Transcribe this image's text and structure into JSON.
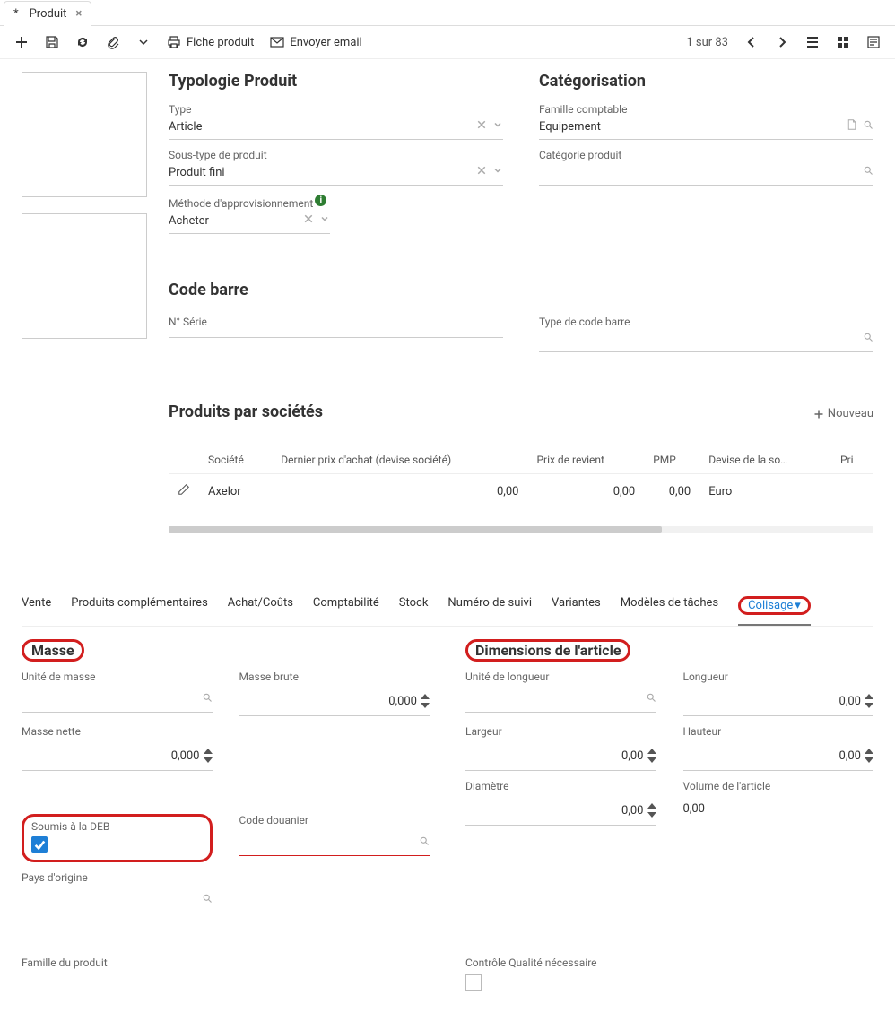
{
  "tab": {
    "prefix": "*",
    "title": "Produit"
  },
  "toolbar": {
    "fiche": "Fiche produit",
    "email": "Envoyer email",
    "pager": "1 sur 83"
  },
  "typologie": {
    "heading": "Typologie Produit",
    "type_label": "Type",
    "type_value": "Article",
    "subtype_label": "Sous-type de produit",
    "subtype_value": "Produit fini",
    "method_label": "Méthode d'approvisionnement",
    "method_value": "Acheter"
  },
  "categorisation": {
    "heading": "Catégorisation",
    "famille_label": "Famille comptable",
    "famille_value": "Equipement",
    "categorie_label": "Catégorie produit"
  },
  "codebarre": {
    "heading": "Code barre",
    "serie_label": "N° Série",
    "type_label": "Type de code barre"
  },
  "societes": {
    "heading": "Produits par sociétés",
    "new_label": "Nouveau",
    "columns": {
      "societe": "Société",
      "dernier_prix": "Dernier prix d'achat (devise société)",
      "prix_revient": "Prix de revient",
      "pmp": "PMP",
      "devise": "Devise de la so…",
      "pri": "Pri"
    },
    "row": {
      "societe": "Axelor",
      "dernier_prix": "0,00",
      "prix_revient": "0,00",
      "pmp": "0,00",
      "devise": "Euro"
    }
  },
  "ptabs": {
    "vente": "Vente",
    "complementaires": "Produits complémentaires",
    "achat": "Achat/Coûts",
    "compta": "Comptabilité",
    "stock": "Stock",
    "suivi": "Numéro de suivi",
    "variantes": "Variantes",
    "modeles": "Modèles de tâches",
    "colisage": "Colisage"
  },
  "masse": {
    "heading": "Masse",
    "unite_label": "Unité de masse",
    "brute_label": "Masse brute",
    "brute_value": "0,000",
    "nette_label": "Masse nette",
    "nette_value": "0,000"
  },
  "dimensions": {
    "heading": "Dimensions de l'article",
    "unite_label": "Unité de longueur",
    "longueur_label": "Longueur",
    "longueur_value": "0,00",
    "largeur_label": "Largeur",
    "largeur_value": "0,00",
    "hauteur_label": "Hauteur",
    "hauteur_value": "0,00",
    "diametre_label": "Diamètre",
    "diametre_value": "0,00",
    "volume_label": "Volume de l'article",
    "volume_value": "0,00"
  },
  "deb": {
    "label": "Soumis à la DEB",
    "douanier_label": "Code douanier",
    "pays_label": "Pays d'origine"
  },
  "bottom": {
    "famille_label": "Famille du produit",
    "qualite_label": "Contrôle Qualité nécessaire"
  }
}
